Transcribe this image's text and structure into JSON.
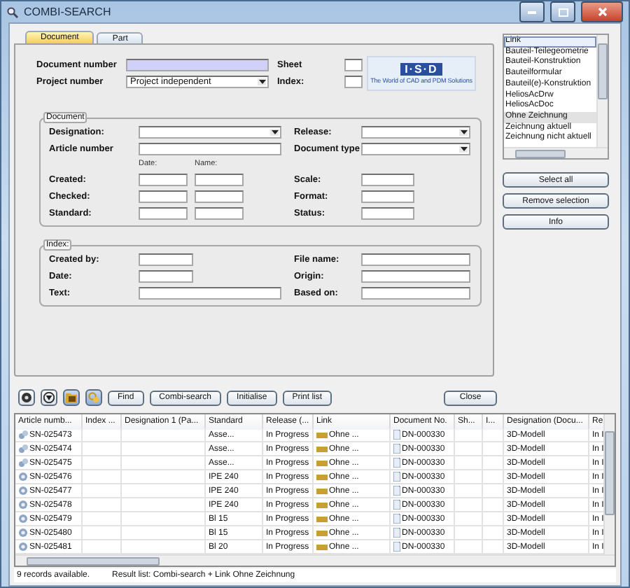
{
  "window": {
    "title": "COMBI-SEARCH"
  },
  "tabs": [
    {
      "label": "Document",
      "selected": true
    },
    {
      "label": "Part",
      "selected": false
    }
  ],
  "top_fields": [
    {
      "label": "Document number",
      "kind": "text",
      "highlighted": true
    },
    {
      "label": "Project number",
      "kind": "dropdown",
      "value": "Project independent",
      "highlighted": false
    }
  ],
  "top_right_fields": [
    {
      "label": "Sheet"
    },
    {
      "label": "Index:"
    }
  ],
  "logo": {
    "mark": "I·S·D",
    "tagline": "The World of CAD and PDM Solutions"
  },
  "document_group": {
    "title": "Document",
    "rows": [
      {
        "kind": "fields",
        "left": {
          "label": "Designation:",
          "kind": "dropdown"
        },
        "right": {
          "label": "Release:",
          "kind": "dropdown"
        }
      },
      {
        "kind": "fields",
        "left": {
          "label": "Article number",
          "kind": "text"
        },
        "right": {
          "label": "Document type",
          "kind": "dropdown"
        }
      },
      {
        "kind": "heads",
        "heads": [
          "Date:",
          "Name:"
        ]
      },
      {
        "kind": "fields",
        "left": {
          "label": "Created:",
          "kind": "pair"
        },
        "right": {
          "label": "Scale:",
          "kind": "short"
        }
      },
      {
        "kind": "fields",
        "left": {
          "label": "Checked:",
          "kind": "pair"
        },
        "right": {
          "label": "Format:",
          "kind": "short"
        }
      },
      {
        "kind": "fields",
        "left": {
          "label": "Standard:",
          "kind": "pair"
        },
        "right": {
          "label": "Status:",
          "kind": "short"
        }
      }
    ]
  },
  "index_group": {
    "title": "Index:",
    "rows": [
      {
        "kind": "fields",
        "left": {
          "label": "Created by:",
          "kind": "short"
        },
        "right": {
          "label": "File name:",
          "kind": "text"
        }
      },
      {
        "kind": "fields",
        "left": {
          "label": "Date:",
          "kind": "short"
        },
        "right": {
          "label": "Origin:",
          "kind": "text"
        }
      },
      {
        "kind": "fields",
        "left": {
          "label": "Text:",
          "kind": "text"
        },
        "right": {
          "label": "Based on:",
          "kind": "text"
        }
      }
    ]
  },
  "link_list": {
    "items": [
      {
        "label": "Link",
        "selected": false,
        "focused": true
      },
      {
        "label": "Bauteil-Teilegeometrie",
        "selected": false,
        "focused": false
      },
      {
        "label": "Bauteil-Konstruktion",
        "selected": false,
        "focused": false
      },
      {
        "label": "Bauteilformular",
        "selected": false,
        "focused": false
      },
      {
        "label": "Bauteil(e)-Konstruktion",
        "selected": false,
        "focused": false
      },
      {
        "label": "HeliosAcDrw",
        "selected": false,
        "focused": false
      },
      {
        "label": "HeliosAcDoc",
        "selected": false,
        "focused": false
      },
      {
        "label": "Ohne Zeichnung",
        "selected": true,
        "focused": false
      },
      {
        "label": "Zeichnung aktuell",
        "selected": false,
        "focused": false
      },
      {
        "label": "Zeichnung nicht aktuell",
        "selected": false,
        "focused": false
      }
    ]
  },
  "side_buttons": [
    "Select all",
    "Remove selection",
    "Info"
  ],
  "toolbar": {
    "icon_buttons": [
      {
        "kind": "reset",
        "pressed": false
      },
      {
        "kind": "filter",
        "pressed": false
      },
      {
        "kind": "folder",
        "pressed": true
      },
      {
        "kind": "link",
        "pressed": true
      }
    ],
    "buttons": [
      "Find",
      "Combi-search",
      "Initialise",
      "Print list"
    ],
    "close_button": "Close"
  },
  "table": {
    "columns": [
      "Article numb...",
      "Index ...",
      "Designation 1 (Pa...",
      "Standard",
      "Release (...",
      "Link",
      "Document No.",
      "Sh...",
      "I...",
      "Designation (Docu...",
      "Re"
    ],
    "rows": [
      {
        "kind": "assembly",
        "article": "SN-025473",
        "standard": "Asse...",
        "release": "In Progress",
        "link": "Ohne ...",
        "document_no": "DN-000330",
        "designation_doc": "3D-Modell",
        "column_11": "In I"
      },
      {
        "kind": "assembly",
        "article": "SN-025474",
        "standard": "Asse...",
        "release": "In Progress",
        "link": "Ohne ...",
        "document_no": "DN-000330",
        "designation_doc": "3D-Modell",
        "column_11": "In I"
      },
      {
        "kind": "assembly",
        "article": "SN-025475",
        "standard": "Asse...",
        "release": "In Progress",
        "link": "Ohne ...",
        "document_no": "DN-000330",
        "designation_doc": "3D-Modell",
        "column_11": "In I"
      },
      {
        "kind": "part",
        "article": "SN-025476",
        "standard": "IPE 240",
        "release": "In Progress",
        "link": "Ohne ...",
        "document_no": "DN-000330",
        "designation_doc": "3D-Modell",
        "column_11": "In I"
      },
      {
        "kind": "part",
        "article": "SN-025477",
        "standard": "IPE 240",
        "release": "In Progress",
        "link": "Ohne ...",
        "document_no": "DN-000330",
        "designation_doc": "3D-Modell",
        "column_11": "In I"
      },
      {
        "kind": "part",
        "article": "SN-025478",
        "standard": "IPE 240",
        "release": "In Progress",
        "link": "Ohne ...",
        "document_no": "DN-000330",
        "designation_doc": "3D-Modell",
        "column_11": "In I"
      },
      {
        "kind": "part",
        "article": "SN-025479",
        "standard": "Bl 15",
        "release": "In Progress",
        "link": "Ohne ...",
        "document_no": "DN-000330",
        "designation_doc": "3D-Modell",
        "column_11": "In I"
      },
      {
        "kind": "part",
        "article": "SN-025480",
        "standard": "Bl 15",
        "release": "In Progress",
        "link": "Ohne ...",
        "document_no": "DN-000330",
        "designation_doc": "3D-Modell",
        "column_11": "In I"
      },
      {
        "kind": "part",
        "article": "SN-025481",
        "standard": "Bl 20",
        "release": "In Progress",
        "link": "Ohne ...",
        "document_no": "DN-000330",
        "designation_doc": "3D-Modell",
        "column_11": "In I"
      }
    ]
  },
  "status_bar": [
    "9 records available.",
    "Result list: Combi-search + Link Ohne Zeichnung"
  ]
}
